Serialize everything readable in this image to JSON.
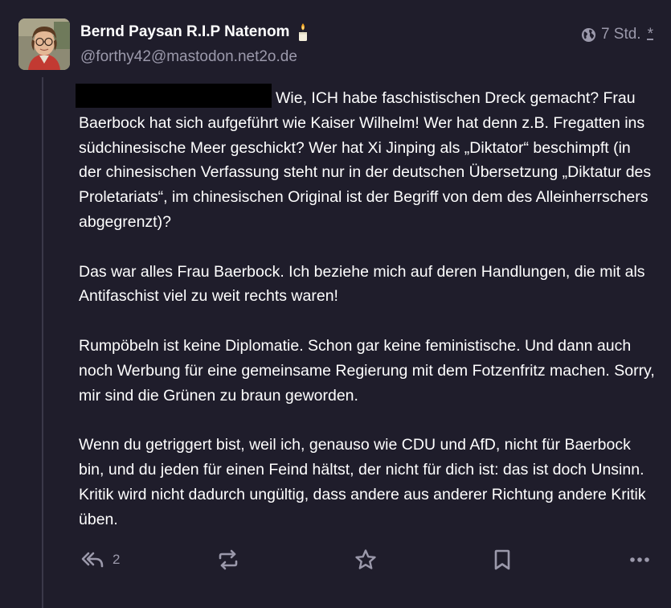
{
  "post": {
    "author": {
      "display_name": "Bernd Paysan R.I.P Natenom",
      "handle": "@forthy42@mastodon.net2o.de"
    },
    "visibility_icon": "globe-icon",
    "timestamp": "7 Std.",
    "edited_marker": "*",
    "paragraphs": {
      "p1": {
        "redacted": true,
        "text": "Wie, ICH habe faschistischen Dreck gemacht? Frau Baerbock hat sich aufgeführt wie Kaiser Wilhelm! Wer hat denn z.B. Fregatten ins südchinesische Meer geschickt? Wer hat Xi Jinping als „Diktator“ beschimpft (in der chinesischen Verfassung steht nur in der deutschen Übersetzung „Diktatur des Proletariats“, im chinesischen Original ist der Begriff von dem des Alleinherrschers abgegrenzt)?"
      },
      "p2": "Das war alles Frau Baerbock. Ich beziehe mich auf deren Handlungen, die mit als Antifaschist viel zu weit rechts waren!",
      "p3": "Rumpöbeln ist keine Diplomatie. Schon gar keine feministische. Und dann auch noch Werbung für eine gemeinsame Regierung mit dem Fotzenfritz machen. Sorry, mir sind die Grünen zu braun geworden.",
      "p4": "Wenn du getriggert bist, weil ich, genauso wie CDU und AfD, nicht für Baerbock bin, und du jeden für einen Feind hältst, der nicht für dich ist: das ist doch Unsinn. Kritik wird nicht dadurch ungültig, dass andere aus anderer Richtung andere Kritik üben."
    },
    "actions": {
      "reply": {
        "icon": "reply-all-icon",
        "count": "2"
      },
      "boost": {
        "icon": "boost-icon"
      },
      "favourite": {
        "icon": "star-icon"
      },
      "bookmark": {
        "icon": "bookmark-icon"
      },
      "more": {
        "icon": "more-horizontal-icon"
      }
    }
  },
  "colors": {
    "background": "#1f1d2b",
    "text": "#ffffff",
    "muted": "#9b99ab",
    "thread_line": "#3a3849",
    "redaction": "#000000"
  }
}
